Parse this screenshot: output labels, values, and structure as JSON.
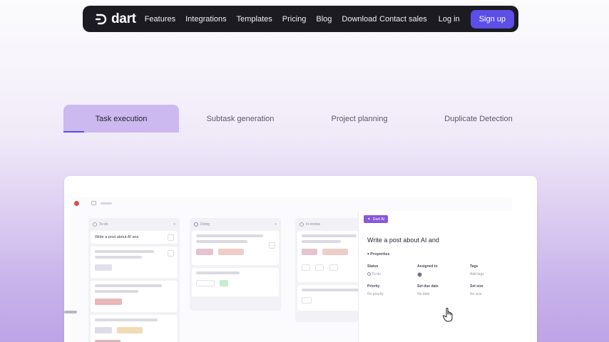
{
  "nav": {
    "brand": "dart",
    "links": [
      "Features",
      "Integrations",
      "Templates",
      "Pricing",
      "Blog",
      "Download"
    ],
    "contact": "Contact sales",
    "login": "Log in",
    "signup": "Sign up"
  },
  "tabs": {
    "items": [
      "Task execution",
      "Subtask generation",
      "Project planning",
      "Duplicate Detection"
    ],
    "active_index": 0,
    "active_progress_fraction": 0.18
  },
  "preview": {
    "columns": [
      {
        "header": "To-do"
      },
      {
        "header": "Doing"
      },
      {
        "header": "In review"
      }
    ],
    "first_task": "Write a post about AI ans",
    "panel": {
      "badge": "Dart AI",
      "title": "Write a post about AI and",
      "properties_heading": "Properties",
      "props": [
        {
          "label": "Status",
          "value": "To-do"
        },
        {
          "label": "Assigned to",
          "value": ""
        },
        {
          "label": "Tags",
          "value": "Add tags"
        },
        {
          "label": "Priority",
          "value": "No priority"
        },
        {
          "label": "Set due date",
          "value": "No date"
        },
        {
          "label": "Set size",
          "value": "No size"
        }
      ]
    }
  },
  "colors": {
    "nav_bg": "#1c1b22",
    "accent": "#5c4ee6",
    "active_tab": "#cbb9f0",
    "ai_badge": "#8a57d9"
  }
}
